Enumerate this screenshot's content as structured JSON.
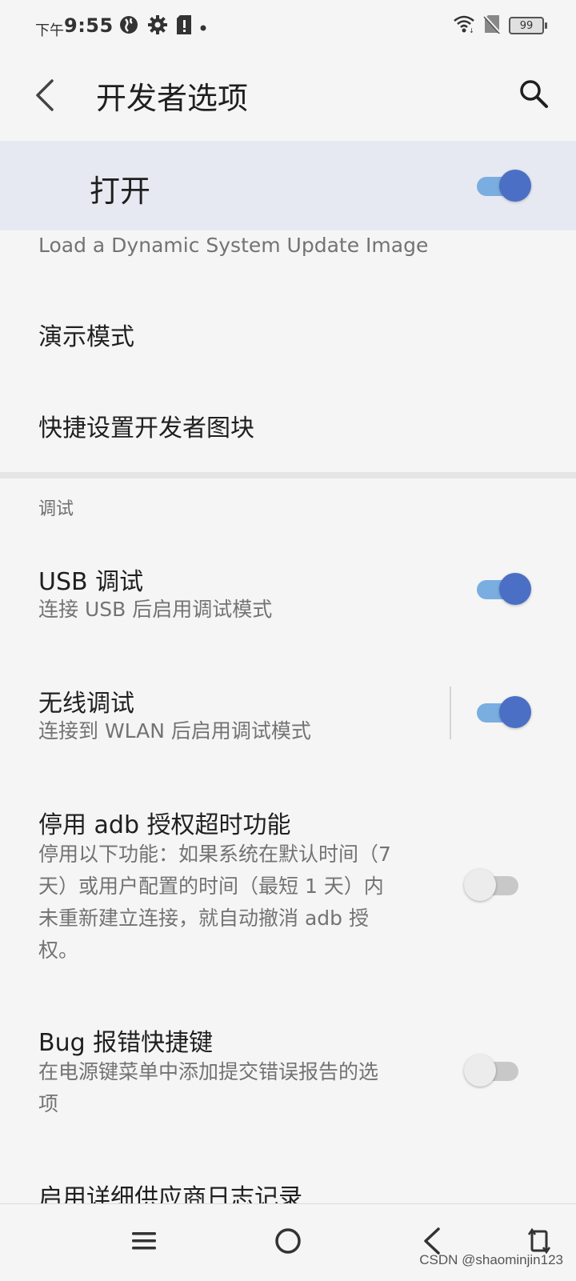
{
  "status_bar": {
    "time_prefix": "下午",
    "time": "9:55",
    "battery": "99",
    "left_icons": [
      "vpn-globe-icon",
      "settings-gear-icon",
      "sim-alert-icon",
      "dot-icon"
    ],
    "right_icons": [
      "wifi-icon",
      "no-sim-icon",
      "battery-icon"
    ]
  },
  "app_bar": {
    "title": "开发者选项",
    "back_icon": "back-arrow-icon",
    "search_icon": "search-icon"
  },
  "master_switch": {
    "label": "打开",
    "checked": true
  },
  "items": [
    {
      "title": "Load a Dynamic System Update Image"
    },
    {
      "title": "演示模式"
    },
    {
      "title": "快捷设置开发者图块"
    }
  ],
  "category": {
    "title": "调试"
  },
  "debug_items": [
    {
      "title": "USB 调试",
      "summary": "连接 USB 后启用调试模式",
      "checked": true
    },
    {
      "title": "无线调试",
      "summary": "连接到 WLAN 后启用调试模式",
      "checked": true
    },
    {
      "title": "停用 adb 授权超时功能",
      "summary_lines": [
        "停用以下功能：如果系统在默认时间（7",
        "天）或用户配置的时间（最短 1 天）内",
        "未重新建立连接，就自动撤消 adb 授",
        "权。"
      ],
      "checked": false
    },
    {
      "title": "Bug 报错快捷键",
      "summary_lines": [
        "在电源键菜单中添加提交错误报告的选",
        "项"
      ],
      "checked": false
    },
    {
      "title": "启用详细供应商日志记录"
    }
  ],
  "nav_bar": {
    "icons": [
      "menu-icon",
      "home-icon",
      "back-icon",
      "rotate-icon"
    ]
  },
  "watermark": "CSDN @shaominjin123",
  "colors": {
    "accent": "#4a6fc5",
    "track_on": "#7aaee0",
    "banner": "#e7e9f2",
    "background": "#f5f5f5"
  }
}
